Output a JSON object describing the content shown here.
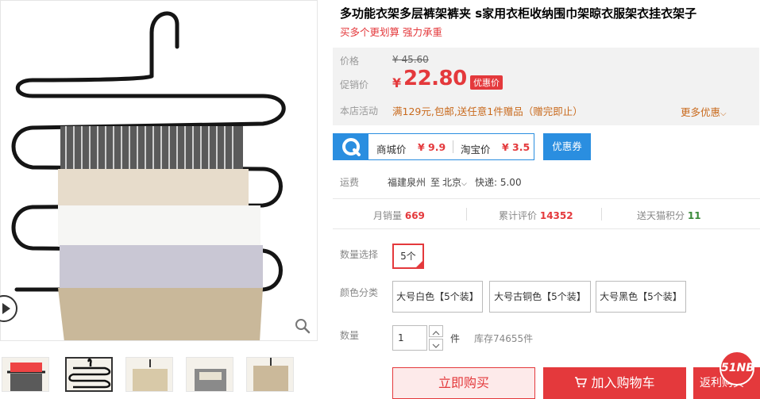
{
  "product": {
    "title": "多功能衣架多层裤架裤夹 s家用衣柜收纳围巾架晾衣服架衣挂衣架子",
    "subtitle": "买多个更划算 强力承重"
  },
  "price": {
    "orig_label": "价格",
    "orig_value": "¥ 45.60",
    "promo_label": "促销价",
    "currency": "¥",
    "current_value": "22.80",
    "promo_tag": "优惠价",
    "activity_label": "本店活动",
    "activity_text": "满129元,包邮,送任意1件赠品（赠完即止）",
    "more_promo": "更多优惠"
  },
  "compare": {
    "mall_label": "商城价",
    "mall_value": "¥ 9.9",
    "taobao_label": "淘宝价",
    "taobao_value": "¥ 3.5",
    "coupon_label": "优惠券"
  },
  "shipping": {
    "label": "运费",
    "origin": "福建泉州",
    "to": "至",
    "dest": "北京",
    "express": "快递: 5.00"
  },
  "stats": {
    "monthly_label": "月销量",
    "monthly_value": "669",
    "reviews_label": "累计评价",
    "reviews_value": "14352",
    "points_label": "送天猫积分",
    "points_value": "11"
  },
  "options": {
    "qty_select_label": "数量选择",
    "qty_option": "5个",
    "color_label": "颜色分类",
    "colors": [
      "大号白色【5个装】",
      "大号古铜色【5个装】",
      "大号黑色【5个装】"
    ],
    "qty_label": "数量",
    "qty_value": "1",
    "unit": "件",
    "stock": "库存74655件"
  },
  "actions": {
    "buy_now": "立即购买",
    "add_cart": "加入购物车",
    "rebate": "返利购买",
    "badge": "51NB"
  },
  "colors": {
    "accent": "#e4393c",
    "blue": "#2a8ee0",
    "promo_orange": "#c96a1d"
  }
}
